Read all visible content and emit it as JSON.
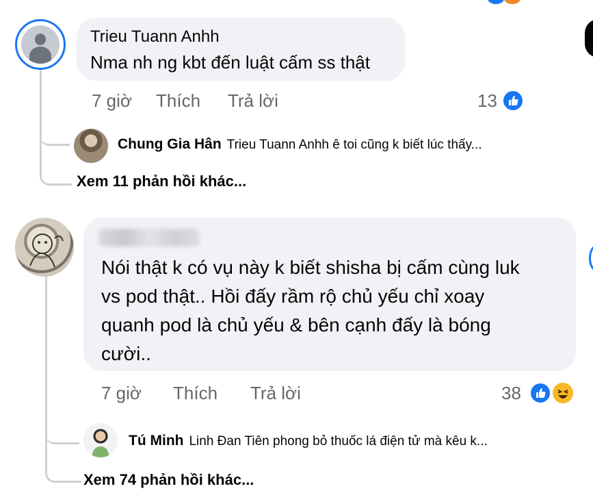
{
  "comments": [
    {
      "author": "Trieu Tuann Anhh",
      "text": "Nma nh ng kbt đến luật cấm ss thật",
      "time": "7 giờ",
      "like": "Thích",
      "reply": "Trả lời",
      "reaction_count": "13",
      "reactions": [
        "like-icon"
      ],
      "replies": [
        {
          "author": "Chung Gia Hân",
          "text": "Trieu Tuann Anhh ê toi cũng k biết lúc thấy..."
        }
      ],
      "more_replies": "Xem 11 phản hồi khác..."
    },
    {
      "author": "",
      "text_lines": [
        "Nói thật k có vụ này k biết shisha bị cấm cùng luk",
        "vs pod thật.. Hồi đấy rầm rộ chủ yếu chỉ xoay",
        "quanh pod là chủ yếu & bên cạnh đấy là bóng",
        "cười.."
      ],
      "time": "7 giờ",
      "like": "Thích",
      "reply": "Trả lời",
      "reaction_count": "38",
      "reactions": [
        "like-icon",
        "haha-icon"
      ],
      "replies": [
        {
          "author": "Tú Minh",
          "text": "Linh Đan Tiên phong bỏ thuốc lá điện tử mà kêu k..."
        }
      ],
      "more_replies": "Xem 74 phản hồi khác..."
    }
  ],
  "colors": {
    "accent": "#1877f2",
    "bubble": "#f0f2f5",
    "meta": "#65676b",
    "line": "#ced0d4"
  }
}
